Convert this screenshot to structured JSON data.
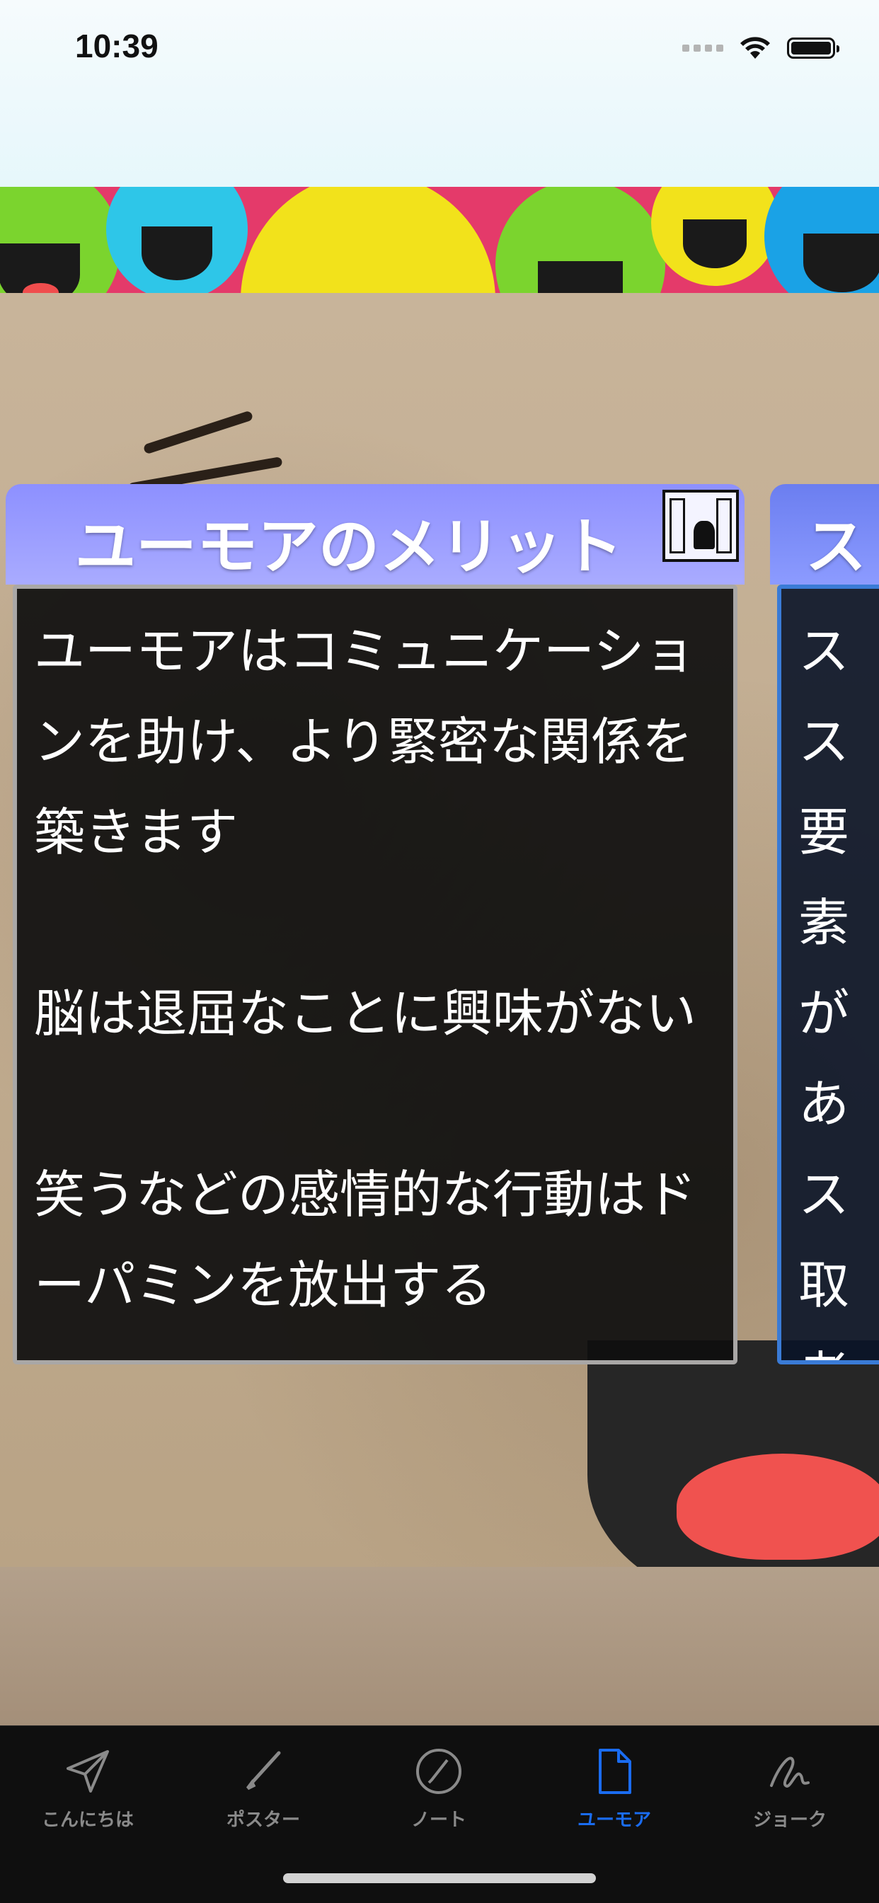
{
  "status_bar": {
    "time": "10:39",
    "icons": [
      "signal-icon",
      "wifi-icon",
      "battery-icon"
    ]
  },
  "banner": {
    "image": "laughing-emoji-balls",
    "colors": [
      "#f2e21b",
      "#2ec6e8",
      "#7bd42e",
      "#e43a6a",
      "#1aa2e6"
    ]
  },
  "cards": [
    {
      "title": "ユーモアのメリット",
      "icon": "window-cat-icon",
      "body": "ユーモアはコミュニケーションを助け、より緊密な関係を築きます\n\n脳は退屈なことに興味がない\n\n笑うなどの感情的な行動はドーパミンを放出する"
    },
    {
      "title": "ス",
      "body": "ス\nス\n要素\nがあ\nス\n取\n者の\nす。\nス"
    }
  ],
  "tab_bar": {
    "tabs": [
      {
        "label": "こんにちは",
        "icon": "paper-plane-icon",
        "active": false
      },
      {
        "label": "ポスター",
        "icon": "pencil-icon",
        "active": false
      },
      {
        "label": "ノート",
        "icon": "pencil-circle-icon",
        "active": false
      },
      {
        "label": "ユーモア",
        "icon": "document-icon",
        "active": true
      },
      {
        "label": "ジョーク",
        "icon": "scribble-icon",
        "active": false
      }
    ]
  },
  "colors": {
    "card_header": "#9a9cff",
    "tab_active": "#1a6cf0",
    "tab_inactive": "#8a8a8a",
    "tabbar_bg": "#0f0f0f"
  }
}
